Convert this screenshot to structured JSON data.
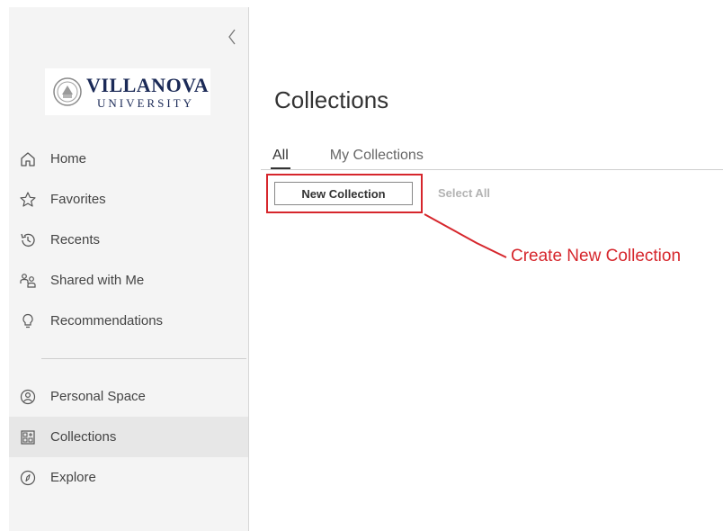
{
  "sidebar": {
    "logo": {
      "name": "VILLANOVA",
      "sub": "UNIVERSITY"
    },
    "nav_top": [
      {
        "label": "Home",
        "icon": "home-icon"
      },
      {
        "label": "Favorites",
        "icon": "star-icon"
      },
      {
        "label": "Recents",
        "icon": "history-icon"
      },
      {
        "label": "Shared with Me",
        "icon": "shared-users-icon"
      },
      {
        "label": "Recommendations",
        "icon": "lightbulb-icon"
      }
    ],
    "nav_bottom": [
      {
        "label": "Personal Space",
        "icon": "user-circle-icon"
      },
      {
        "label": "Collections",
        "icon": "collections-grid-icon",
        "active": true
      },
      {
        "label": "Explore",
        "icon": "compass-icon"
      }
    ]
  },
  "main": {
    "title": "Collections",
    "tabs": [
      {
        "label": "All",
        "selected": true
      },
      {
        "label": "My Collections",
        "selected": false
      }
    ],
    "new_collection_label": "New Collection",
    "select_all_label": "Select All"
  },
  "annotation": {
    "callout_text": "Create New Collection",
    "color": "#d6262c"
  },
  "colors": {
    "sidebar_bg": "#f4f4f4",
    "active_item_bg": "#e7e7e7",
    "logo_navy": "#1b2a57"
  }
}
